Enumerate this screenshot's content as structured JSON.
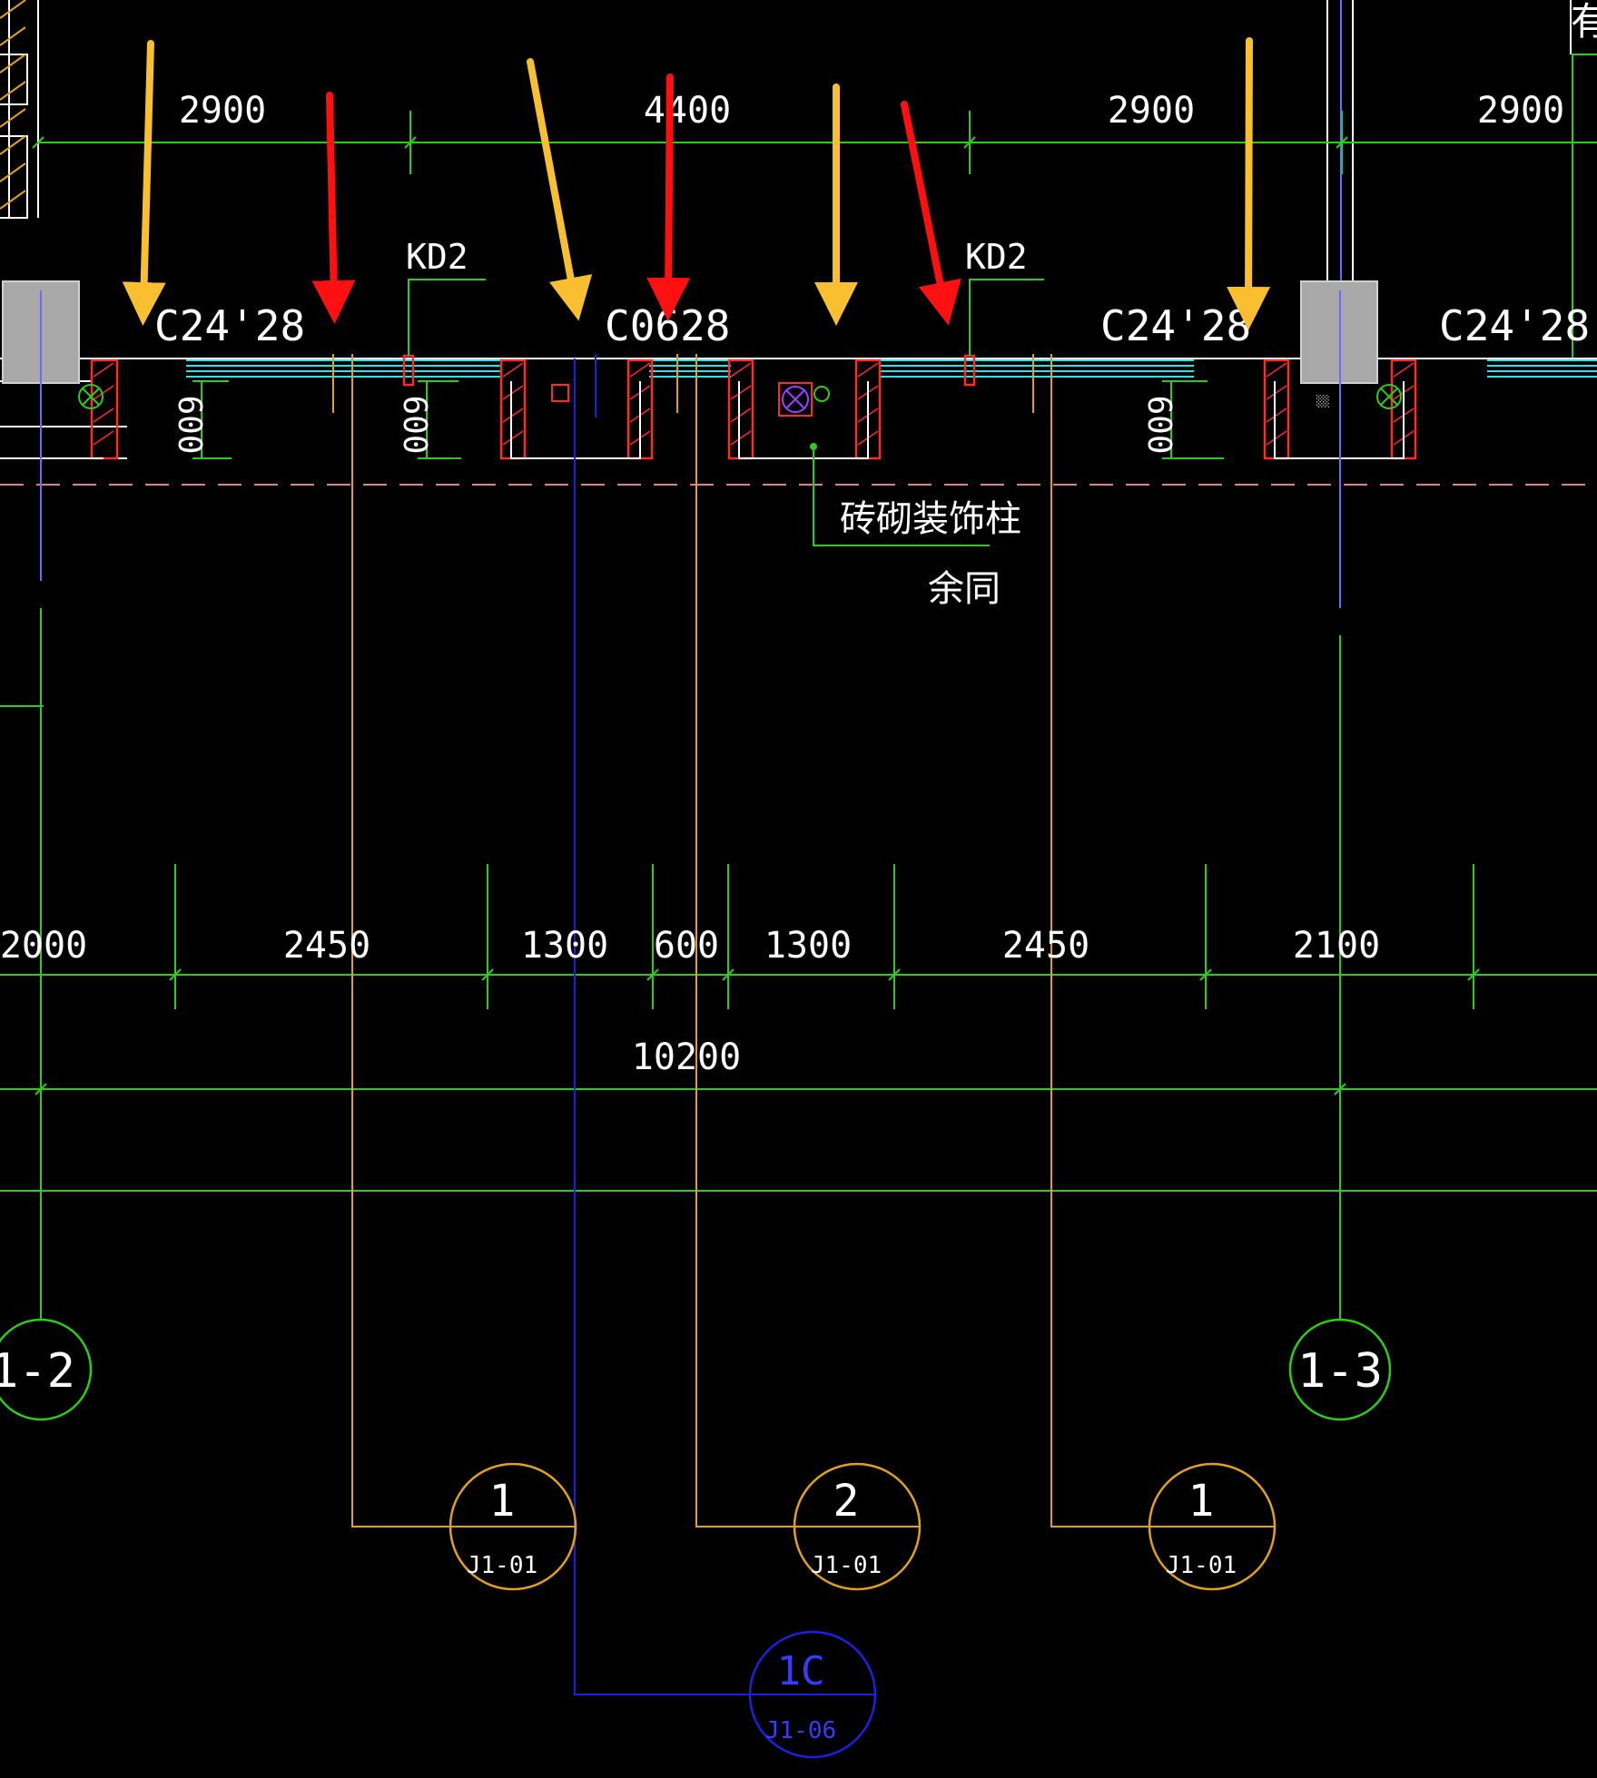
{
  "colors": {
    "background": "#000000",
    "axis_line": "#2ecc1a",
    "wall_red": "#ff2a2a",
    "glass_cyan": "#35e0e0",
    "leader_orange": "#e0a020",
    "leader_blue": "#1c20e0",
    "column_gray": "#a8a8a8",
    "arrow_yellow": "#f8c030",
    "arrow_red": "#ff1010",
    "text": "#ffffff",
    "dashed_pink": "#e08080"
  },
  "top_text": {
    "corner": "有"
  },
  "top_dims": [
    "2900",
    "4400",
    "2900",
    "2900"
  ],
  "window_tags": [
    "C24'28",
    "C0628",
    "C24'28",
    "C24'28"
  ],
  "door_tags": [
    "KD2",
    "KD2"
  ],
  "depth_dims": [
    "600",
    "600",
    "600"
  ],
  "column_note": {
    "line1": "砖砌装饰柱",
    "line2": "余同"
  },
  "column_small_mark": "░░",
  "bottom_dims": [
    "2000",
    "2450",
    "1300",
    "600",
    "1300",
    "2450",
    "2100"
  ],
  "overall_dim": "10200",
  "axis_bubbles": [
    {
      "label": "1-2"
    },
    {
      "label": "1-3"
    }
  ],
  "section_bubbles": [
    {
      "number": "1",
      "sheet": "J1-01"
    },
    {
      "number": "2",
      "sheet": "J1-01"
    },
    {
      "number": "1",
      "sheet": "J1-01"
    }
  ],
  "detail_bubble": {
    "number": "1C",
    "sheet": "J1-06"
  },
  "arrows": [
    {
      "color": "yellow",
      "icon": "down-arrow-icon"
    },
    {
      "color": "red",
      "icon": "down-arrow-icon"
    },
    {
      "color": "yellow",
      "icon": "down-arrow-icon"
    },
    {
      "color": "red",
      "icon": "down-arrow-icon"
    },
    {
      "color": "yellow",
      "icon": "down-arrow-icon"
    },
    {
      "color": "red",
      "icon": "down-arrow-icon"
    },
    {
      "color": "yellow",
      "icon": "down-arrow-icon"
    }
  ]
}
